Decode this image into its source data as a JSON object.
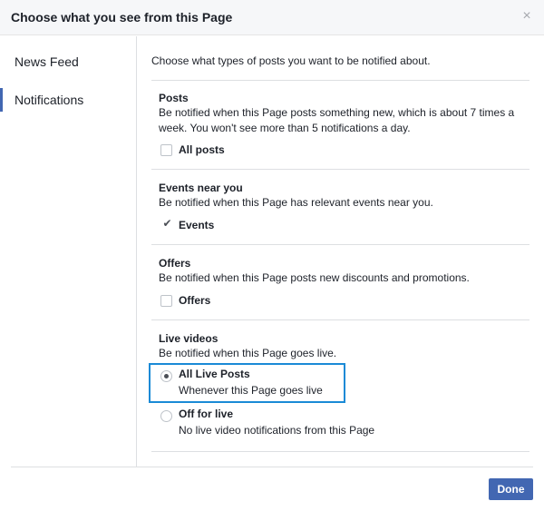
{
  "dialog": {
    "title": "Choose what you see from this Page",
    "close_glyph": "×"
  },
  "sidebar": {
    "items": [
      {
        "label": "News Feed",
        "active": false
      },
      {
        "label": "Notifications",
        "active": true
      }
    ]
  },
  "content": {
    "intro": "Choose what types of posts you want to be notified about.",
    "sections": [
      {
        "title": "Posts",
        "description": "Be notified when this Page posts something new, which is about 7 times a week. You won't see more than 5 notifications a day.",
        "option_label": "All posts",
        "checked": false
      },
      {
        "title": "Events near you",
        "description": "Be notified when this Page has relevant events near you.",
        "option_label": "Events",
        "checked": true
      },
      {
        "title": "Offers",
        "description": "Be notified when this Page posts new discounts and promotions.",
        "option_label": "Offers",
        "checked": false
      },
      {
        "title": "Live videos",
        "description": "Be notified when this Page goes live.",
        "options": [
          {
            "label": "All Live Posts",
            "sublabel": "Whenever this Page goes live",
            "selected": true
          },
          {
            "label": "Off for live",
            "sublabel": "No live video notifications from this Page",
            "selected": false
          }
        ]
      }
    ]
  },
  "footer": {
    "done_label": "Done"
  },
  "colors": {
    "accent": "#4267b2",
    "highlight": "#1a8ad6",
    "header_bg": "#f6f7f9",
    "divider": "#dddfe2"
  },
  "icons": {
    "close": "close-icon",
    "check": "checkmark-icon"
  }
}
